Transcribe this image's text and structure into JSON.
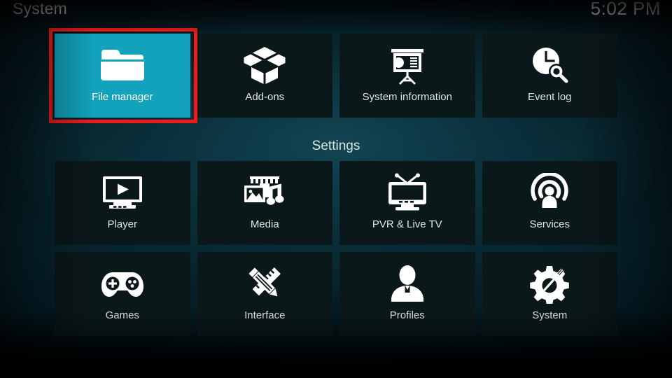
{
  "header": {
    "title": "System",
    "clock": "5:02 PM"
  },
  "colors": {
    "highlight": "#12a2bc",
    "focus_border": "#ef1b1b",
    "tile_background": "#0b181a",
    "text": "#dfe7e9"
  },
  "sections": {
    "settings_heading": "Settings"
  },
  "top_row": [
    {
      "label": "File manager",
      "icon": "folder-icon",
      "selected": true,
      "focused": true
    },
    {
      "label": "Add-ons",
      "icon": "open-box-icon",
      "selected": false,
      "focused": false
    },
    {
      "label": "System information",
      "icon": "presentation-chart-icon",
      "selected": false,
      "focused": false
    },
    {
      "label": "Event log",
      "icon": "clock-search-icon",
      "selected": false,
      "focused": false
    }
  ],
  "settings_row_1": [
    {
      "label": "Player",
      "icon": "monitor-play-icon",
      "selected": false,
      "focused": false
    },
    {
      "label": "Media",
      "icon": "film-photo-music-icon",
      "selected": false,
      "focused": false
    },
    {
      "label": "PVR & Live TV",
      "icon": "television-antenna-icon",
      "selected": false,
      "focused": false
    },
    {
      "label": "Services",
      "icon": "broadcast-person-icon",
      "selected": false,
      "focused": false
    }
  ],
  "settings_row_2": [
    {
      "label": "Games",
      "icon": "gamepad-icon",
      "selected": false,
      "focused": false
    },
    {
      "label": "Interface",
      "icon": "pencil-ruler-icon",
      "selected": false,
      "focused": false
    },
    {
      "label": "Profiles",
      "icon": "person-bust-icon",
      "selected": false,
      "focused": false
    },
    {
      "label": "System",
      "icon": "gear-tools-icon",
      "selected": false,
      "focused": false
    }
  ]
}
